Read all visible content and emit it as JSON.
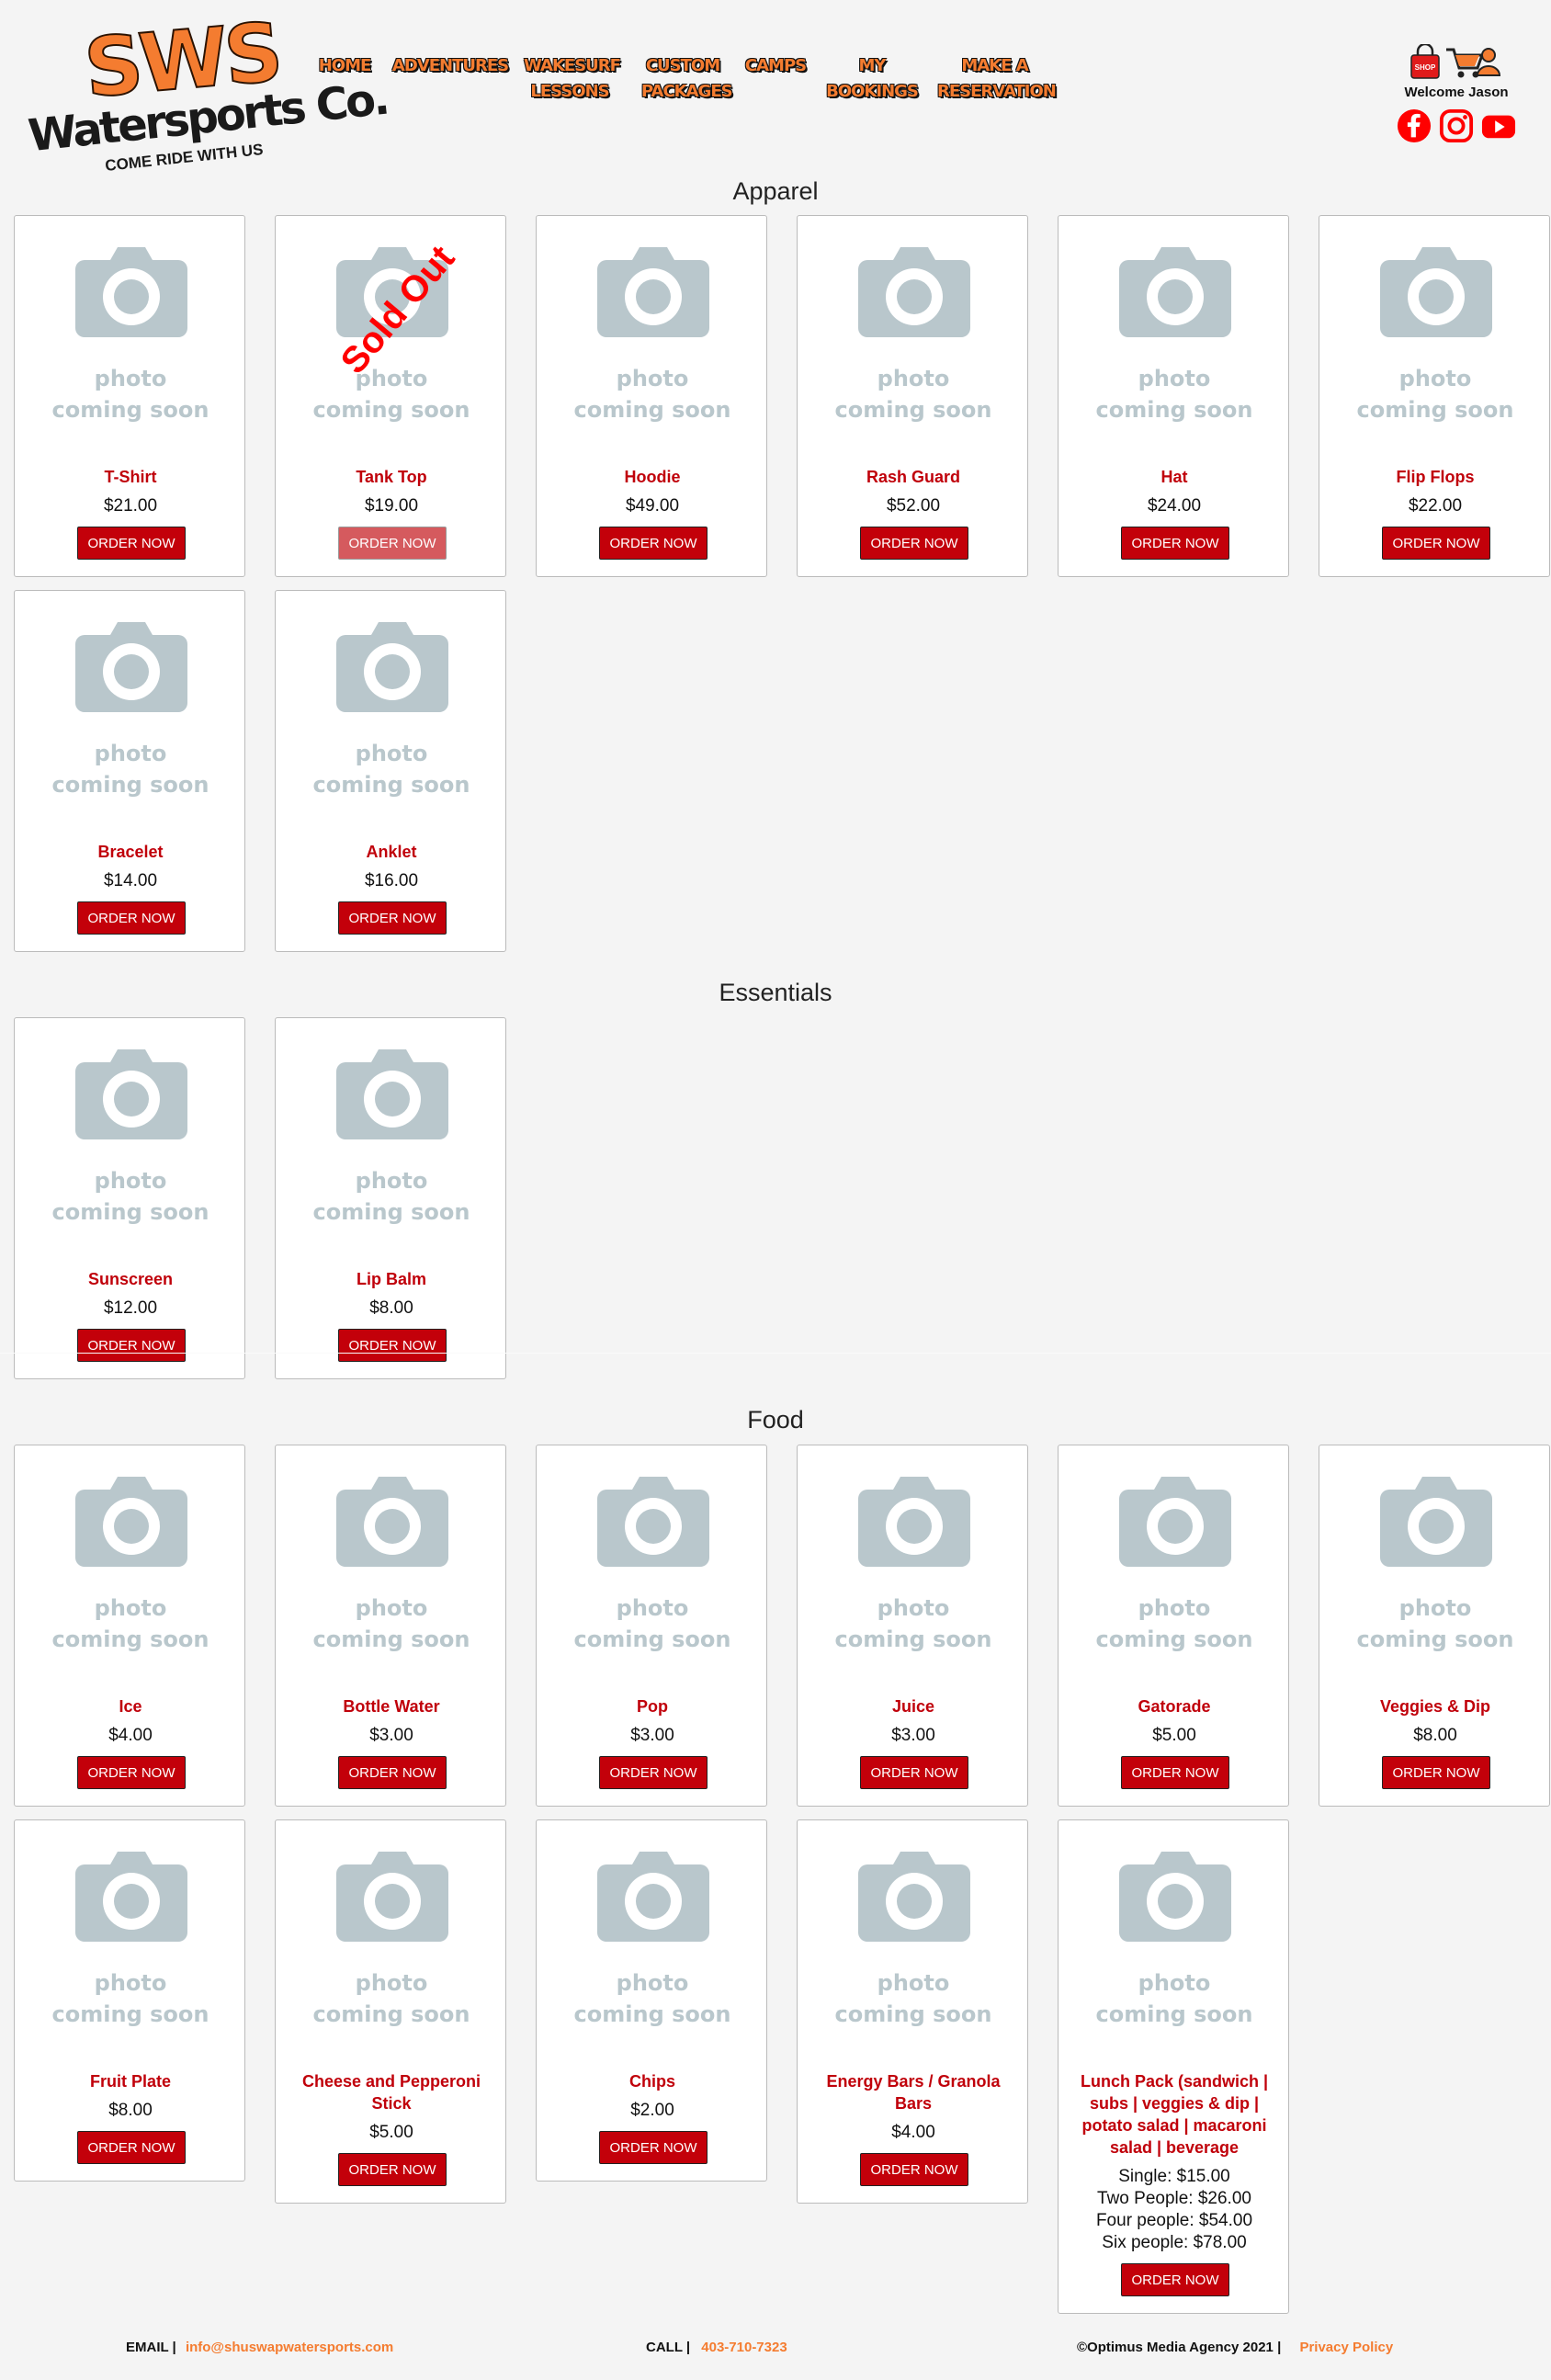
{
  "logo": {
    "line1": "SWS",
    "line2": "Watersports Co.",
    "tagline": "COME RIDE WITH US"
  },
  "nav": {
    "items": [
      {
        "lines": [
          "HOME"
        ]
      },
      {
        "lines": [
          "ADVENTURES"
        ]
      },
      {
        "lines": [
          "WAKESURF",
          "LESSONS"
        ]
      },
      {
        "lines": [
          "CUSTOM",
          "PACKAGES"
        ]
      },
      {
        "lines": [
          "CAMPS"
        ]
      },
      {
        "lines": [
          "MY",
          "BOOKINGS"
        ]
      },
      {
        "lines": [
          "MAKE A",
          "RESERVATION"
        ]
      }
    ]
  },
  "user": {
    "shop_badge": "SHOP",
    "welcome": "Welcome Jason"
  },
  "social": [
    "facebook-icon",
    "instagram-icon",
    "youtube-icon"
  ],
  "photo_placeholder": {
    "line1": "photo",
    "line2": "coming soon"
  },
  "order_label": "ORDER NOW",
  "sold_out_label": "Sold Out",
  "sections": [
    {
      "title": "Apparel",
      "products": [
        {
          "name": "T-Shirt",
          "price": "$21.00"
        },
        {
          "name": "Tank Top",
          "price": "$19.00",
          "sold_out": true
        },
        {
          "name": "Hoodie",
          "price": "$49.00"
        },
        {
          "name": "Rash Guard",
          "price": "$52.00"
        },
        {
          "name": "Hat",
          "price": "$24.00"
        },
        {
          "name": "Flip Flops",
          "price": "$22.00"
        },
        {
          "name": "Bracelet",
          "price": "$14.00"
        },
        {
          "name": "Anklet",
          "price": "$16.00"
        }
      ]
    },
    {
      "title": "Essentials",
      "products": [
        {
          "name": "Sunscreen",
          "price": "$12.00"
        },
        {
          "name": "Lip Balm",
          "price": "$8.00"
        }
      ]
    },
    {
      "title": "Food",
      "products": [
        {
          "name": "Ice",
          "price": "$4.00"
        },
        {
          "name": "Bottle Water",
          "price": "$3.00"
        },
        {
          "name": "Pop",
          "price": "$3.00"
        },
        {
          "name": "Juice",
          "price": "$3.00"
        },
        {
          "name": "Gatorade",
          "price": "$5.00"
        },
        {
          "name": "Veggies & Dip",
          "price": "$8.00"
        },
        {
          "name": "Fruit Plate",
          "price": "$8.00"
        },
        {
          "name": "Cheese and Pepperoni Stick",
          "price": "$5.00"
        },
        {
          "name": "Chips",
          "price": "$2.00"
        },
        {
          "name": "Energy Bars / Granola Bars",
          "price": "$4.00"
        },
        {
          "name": "Lunch Pack (sandwich | subs | veggies & dip | potato salad | macaroni salad | beverage",
          "price_lines": [
            "Single: $15.00",
            "Two People: $26.00",
            "Four people: $54.00",
            "Six people: $78.00"
          ]
        }
      ]
    }
  ],
  "footer": {
    "email_label": "EMAIL |",
    "email": "info@shuswapwatersports.com",
    "call_label": "CALL |",
    "phone": "403-710-7323",
    "copyright": "©Optimus Media Agency 2021 |",
    "privacy": "Privacy Policy"
  },
  "colors": {
    "brand_orange": "#f47c30",
    "product_red": "#c0000a",
    "button_red": "#c3000a",
    "placeholder_gray": "#b9c7cc"
  }
}
